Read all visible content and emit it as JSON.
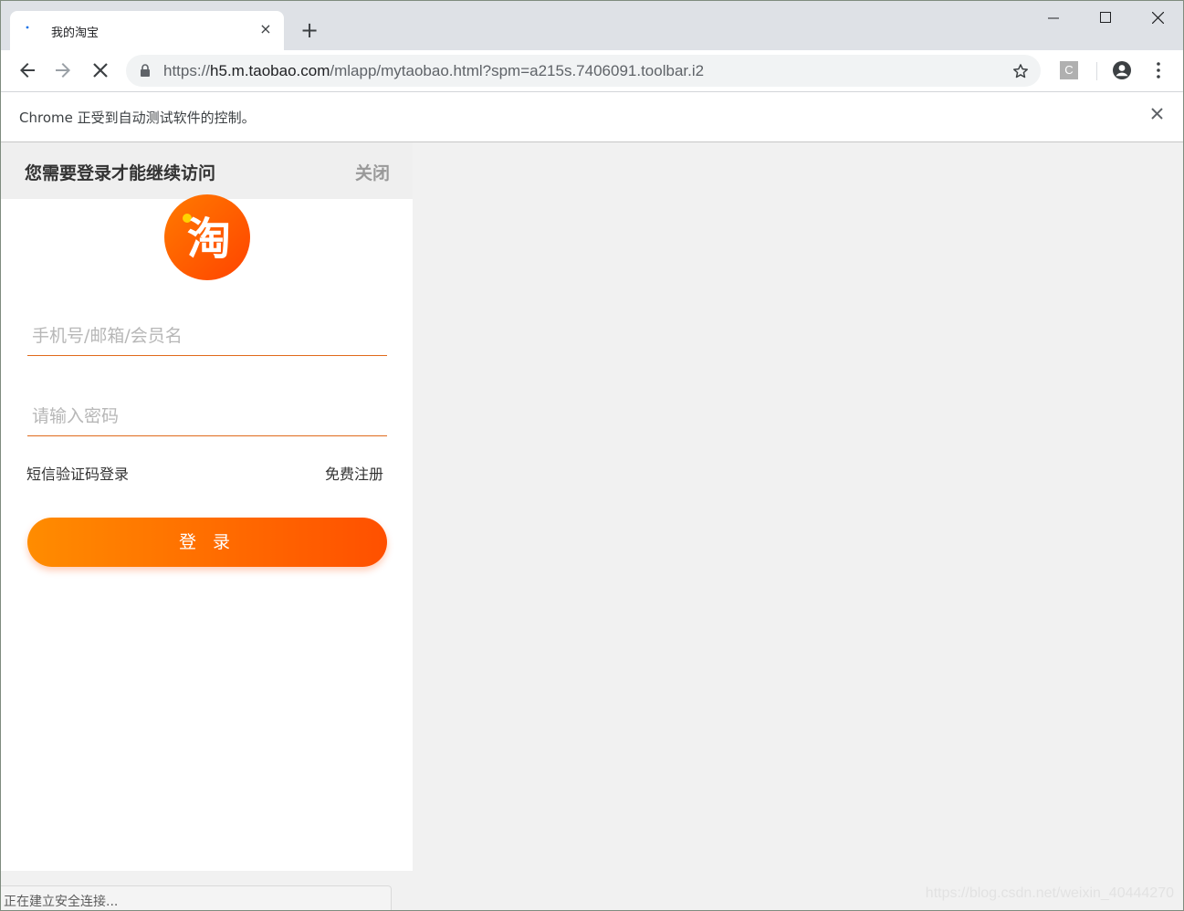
{
  "browser": {
    "tab_title": "我的淘宝",
    "tab_close": "×",
    "new_tab": "+",
    "url_scheme": "https://",
    "url_host": "h5.m.taobao.com",
    "url_path": "/mlapp/mytaobao.html?spm=a215s.7406091.toolbar.i2",
    "extension_letter": "C",
    "infobar_text": "Chrome 正受到自动测试软件的控制。",
    "status_text": "正在建立安全连接...",
    "accent": "#1a73e8"
  },
  "login": {
    "header_title": "您需要登录才能继续访问",
    "header_close": "关闭",
    "logo_char": "淘",
    "username_placeholder": "手机号/邮箱/会员名",
    "password_placeholder": "请输入密码",
    "sms_login": "短信验证码登录",
    "register": "免费注册",
    "login_button": "登 录",
    "brand_color": "#ff5000"
  },
  "watermark": "https://blog.csdn.net/weixin_40444270"
}
